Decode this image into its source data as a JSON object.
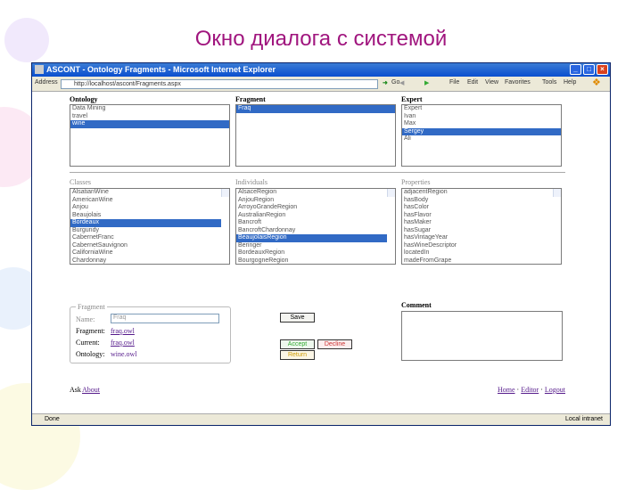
{
  "slide_title": "Окно диалога с системой",
  "window": {
    "title": "ASCONT - Ontology Fragments - Microsoft Internet Explorer",
    "address_label": "Address",
    "url": "http://localhost/ascont/Fragments.aspx",
    "go": "Go",
    "menu": [
      "File",
      "Edit",
      "View",
      "Favorites",
      "Tools",
      "Help"
    ]
  },
  "ontology": {
    "label": "Ontology",
    "items": [
      "Data Mining",
      "travel",
      "wine"
    ],
    "selected": 2
  },
  "fragment": {
    "label": "Fragment",
    "items": [
      "Fraq"
    ],
    "selected": 0
  },
  "expert": {
    "label": "Expert",
    "items": [
      "Expert",
      "Ivan",
      "Max",
      "Sergey",
      "Ali"
    ],
    "selected": 3
  },
  "classes": {
    "label": "Classes",
    "items": [
      "AlsatianWine",
      "AmericanWine",
      "Anjou",
      "Beaujolais",
      "Bordeaux",
      "Burgundy",
      "CabernetFranc",
      "CabernetSauvignon",
      "CaliforniaWine",
      "Chardonnay"
    ],
    "selected": 4
  },
  "individuals": {
    "label": "Individuals",
    "items": [
      "AlsaceRegion",
      "AnjouRegion",
      "ArroyoGrandeRegion",
      "AustralianRegion",
      "Bancroft",
      "BancroftChardonnay",
      "BeaujolaisRegion",
      "Beringer",
      "BordeauxRegion",
      "BourgogneRegion"
    ],
    "selected": 6
  },
  "properties": {
    "label": "Properties",
    "items": [
      "adjacentRegion",
      "hasBody",
      "hasColor",
      "hasFlavor",
      "hasMaker",
      "hasSugar",
      "hasVintageYear",
      "hasWineDescriptor",
      "locatedIn",
      "madeFromGrape"
    ]
  },
  "fragment_box": {
    "legend": "Fragment",
    "name_label": "Name:",
    "name_value": "Fraq",
    "fragment_label": "Fragment:",
    "fragment_link": "fraq.owl",
    "current_label": "Current:",
    "current_link": "fraq.owl",
    "ontology_label": "Ontology:",
    "ontology_value": "wine.owl"
  },
  "buttons": {
    "save": "Save",
    "accept": "Accept",
    "decline": "Decline",
    "return": "Return"
  },
  "comment": {
    "label": "Comment",
    "value": ""
  },
  "footer": {
    "left_prefix": "Ask",
    "left_link": "About",
    "right_links": [
      "Home",
      "Editor",
      "Logout"
    ]
  },
  "status": {
    "left": "Done",
    "right": "Local intranet"
  }
}
